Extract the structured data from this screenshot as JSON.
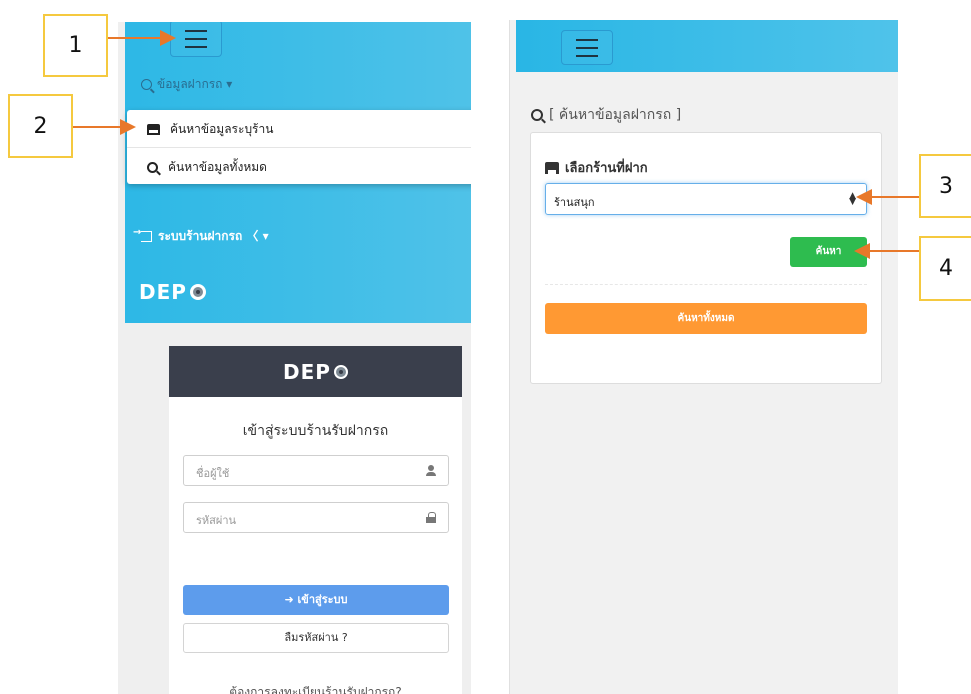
{
  "left_phone": {
    "nav_search_label": "ข้อมูลฝากรถ ▾",
    "dropdown": [
      {
        "label": "ค้นหาข้อมูลระบุร้าน"
      },
      {
        "label": "ค้นหาข้อมูลทั้งหมด"
      }
    ],
    "nav_system_label": "ระบบร้านฝากรถ 〈 ▾",
    "logo_text": "DEP",
    "login": {
      "logo_text": "DEP",
      "title": "เข้าสู่ระบบร้านรับฝากรถ",
      "username_placeholder": "ชื่อผู้ใช้",
      "password_placeholder": "รหัสผ่าน",
      "login_button": "➜ เข้าสู่ระบบ",
      "forgot_button": "ลืมรหัสผ่าน ?",
      "register_text": "ต้องการลงทะเบียนร้านรับฝากรถ?"
    }
  },
  "right_phone": {
    "page_title": "[ ค้นหาข้อมูลฝากรถ ]",
    "store_label": "เลือกร้านที่ฝาก",
    "selected_store": "ร้านสนุก",
    "search_button": "ค้นหา",
    "search_all_button": "ค้นหาทั้งหมด"
  },
  "callouts": [
    "1",
    "2",
    "3",
    "4"
  ],
  "colors": {
    "header_blue": "#2db8e6",
    "login_blue": "#5d9cec",
    "search_green": "#2ebc4f",
    "search_all_orange": "#ff9933",
    "callout_border": "#f5c93f",
    "arrow_orange": "#e8782a",
    "login_header_dark": "#3a3f4c"
  }
}
